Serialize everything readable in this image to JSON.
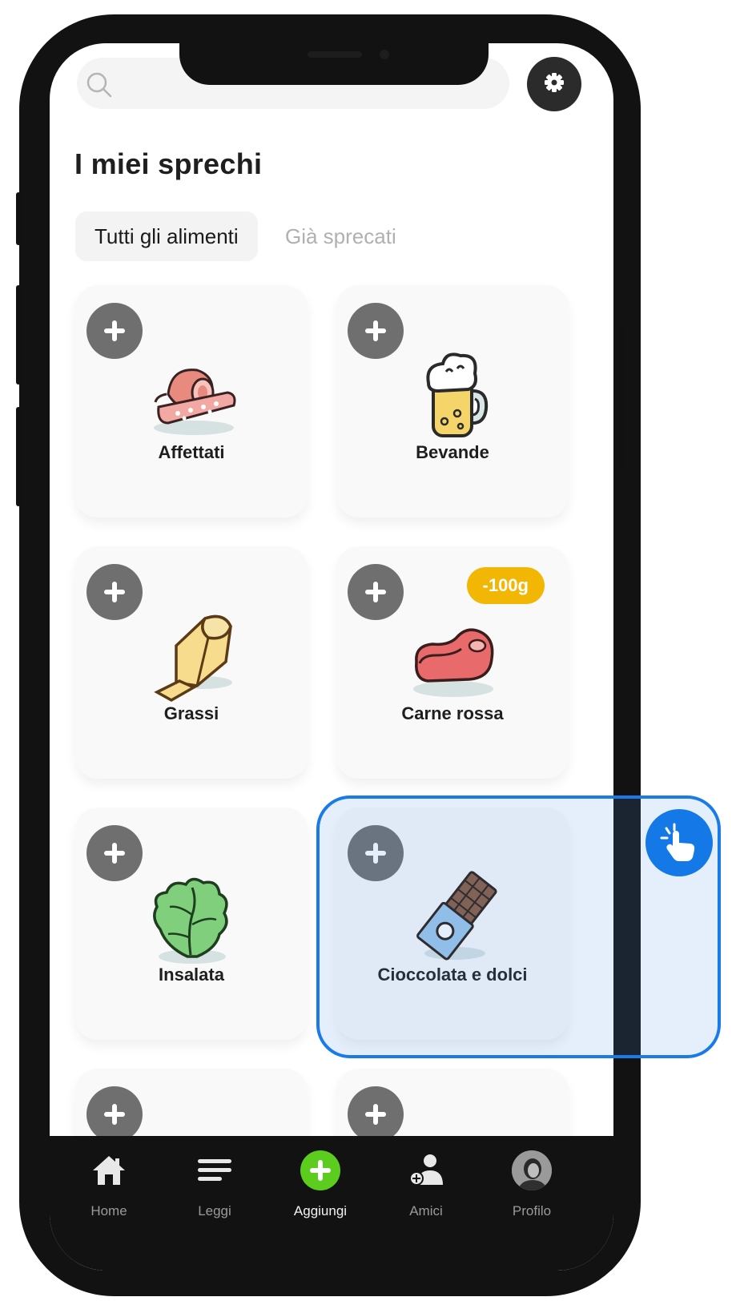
{
  "header": {
    "search_icon": "search-icon",
    "settings_icon": "gear-icon"
  },
  "page": {
    "title": "I miei sprechi"
  },
  "tabs": [
    {
      "label": "Tutti gli alimenti",
      "active": true
    },
    {
      "label": "Già sprecati",
      "active": false
    }
  ],
  "categories": [
    {
      "label": "Affettati",
      "icon": "cold-cuts-icon"
    },
    {
      "label": "Bevande",
      "icon": "beer-mug-icon"
    },
    {
      "label": "Grassi",
      "icon": "butter-icon"
    },
    {
      "label": "Carne rossa",
      "icon": "steak-icon",
      "badge": "-100g"
    },
    {
      "label": "Insalata",
      "icon": "lettuce-icon"
    },
    {
      "label": "Cioccolata e dolci",
      "icon": "chocolate-bar-icon"
    }
  ],
  "nav": [
    {
      "label": "Home",
      "icon": "home-icon",
      "active": false
    },
    {
      "label": "Leggi",
      "icon": "menu-lines-icon",
      "active": false
    },
    {
      "label": "Aggiungi",
      "icon": "add-circle-icon",
      "active": true
    },
    {
      "label": "Amici",
      "icon": "add-friend-icon",
      "active": false
    },
    {
      "label": "Profilo",
      "icon": "avatar-icon",
      "active": false
    }
  ],
  "colors": {
    "accent_green": "#5ccc1f",
    "badge_yellow": "#f2b705",
    "highlight_blue": "#1a7be8"
  }
}
